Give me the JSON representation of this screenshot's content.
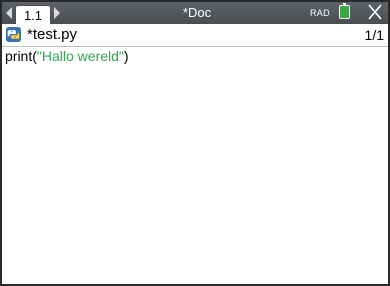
{
  "topbar": {
    "page_tab_label": "1.1",
    "document_title": "*Doc",
    "angle_mode": "RAD",
    "battery_color": "#3aa845"
  },
  "editor": {
    "file_name": "*test.py",
    "page_counter": "1/1",
    "code_lines": [
      {
        "function": "print",
        "open": "(",
        "string": "\"Hallo wereld\"",
        "close": ")"
      }
    ]
  },
  "colors": {
    "topbar_bg": "#4f5357",
    "string_color": "#2ea84a",
    "python_icon_blue": "#3a72b0",
    "python_icon_yellow": "#ffd43b"
  },
  "icons": {
    "nav_left": "triangle-left",
    "nav_right": "triangle-right",
    "battery": "battery-icon",
    "close": "close-x-icon",
    "python": "python-logo-icon"
  }
}
